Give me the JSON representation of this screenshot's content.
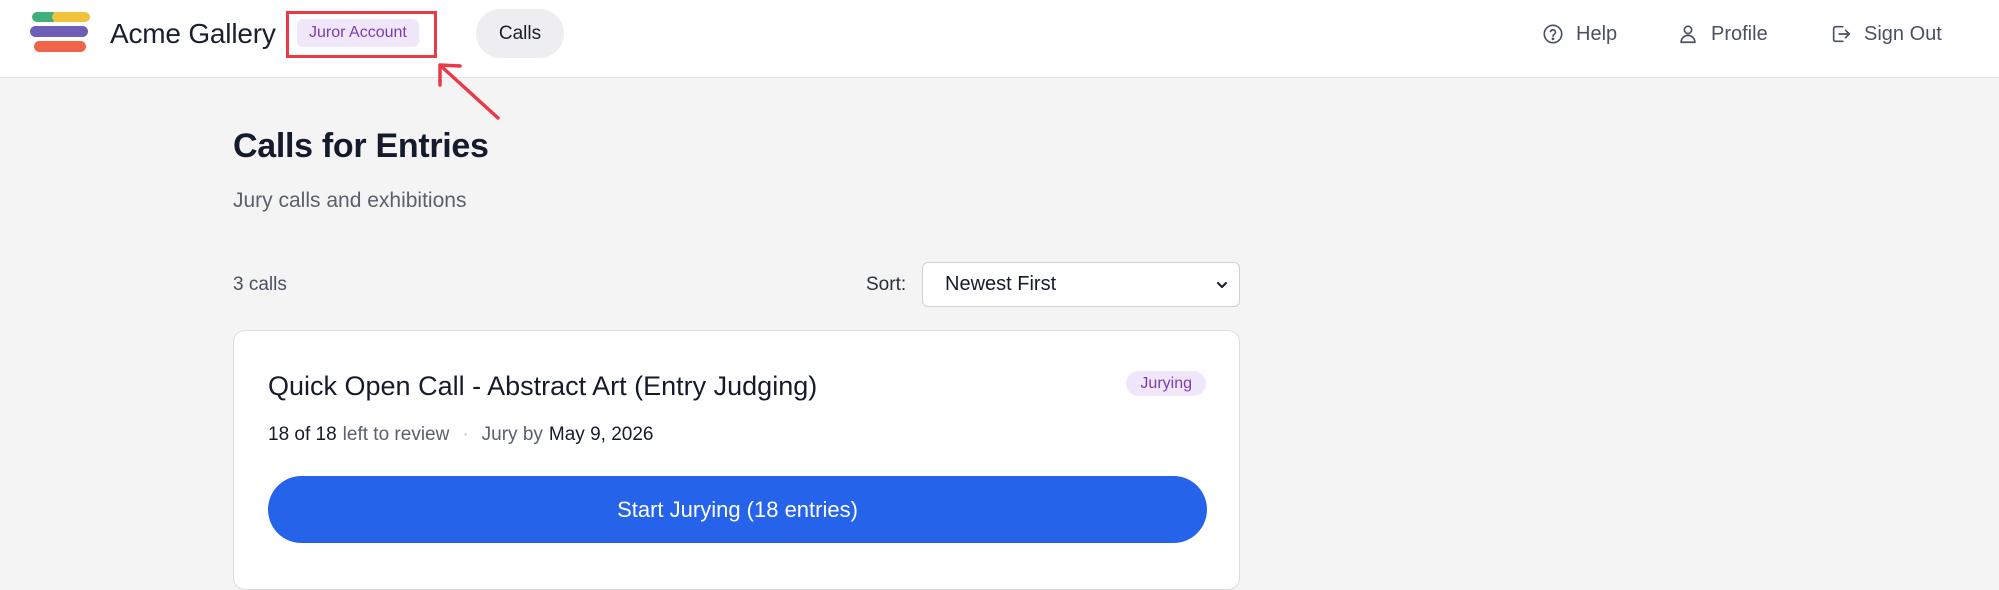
{
  "header": {
    "brand": "Acme Gallery",
    "role_badge": "Juror Account",
    "nav_calls": "Calls",
    "help": "Help",
    "profile": "Profile",
    "sign_out": "Sign Out",
    "logo_colors": [
      "#3fb07a",
      "#f2c23d",
      "#6d5fb8",
      "#f0644a"
    ]
  },
  "page": {
    "title": "Calls for Entries",
    "subtitle": "Jury calls and exhibitions"
  },
  "list": {
    "count": "3 calls",
    "sort_label": "Sort:",
    "sort_value": "Newest First"
  },
  "call": {
    "title": "Quick Open Call - Abstract Art (Entry Judging)",
    "status": "Jurying",
    "progress": "18 of 18",
    "progress_suffix": "left to review",
    "separator": "·",
    "jury_by_label": "Jury by",
    "jury_by_date": "May 9, 2026",
    "cta": "Start Jurying (18 entries)"
  },
  "colors": {
    "accent": "#2563eb",
    "badge_bg": "#f1e7fb",
    "badge_text": "#7a3cb0",
    "annotation": "#ea3a48"
  }
}
